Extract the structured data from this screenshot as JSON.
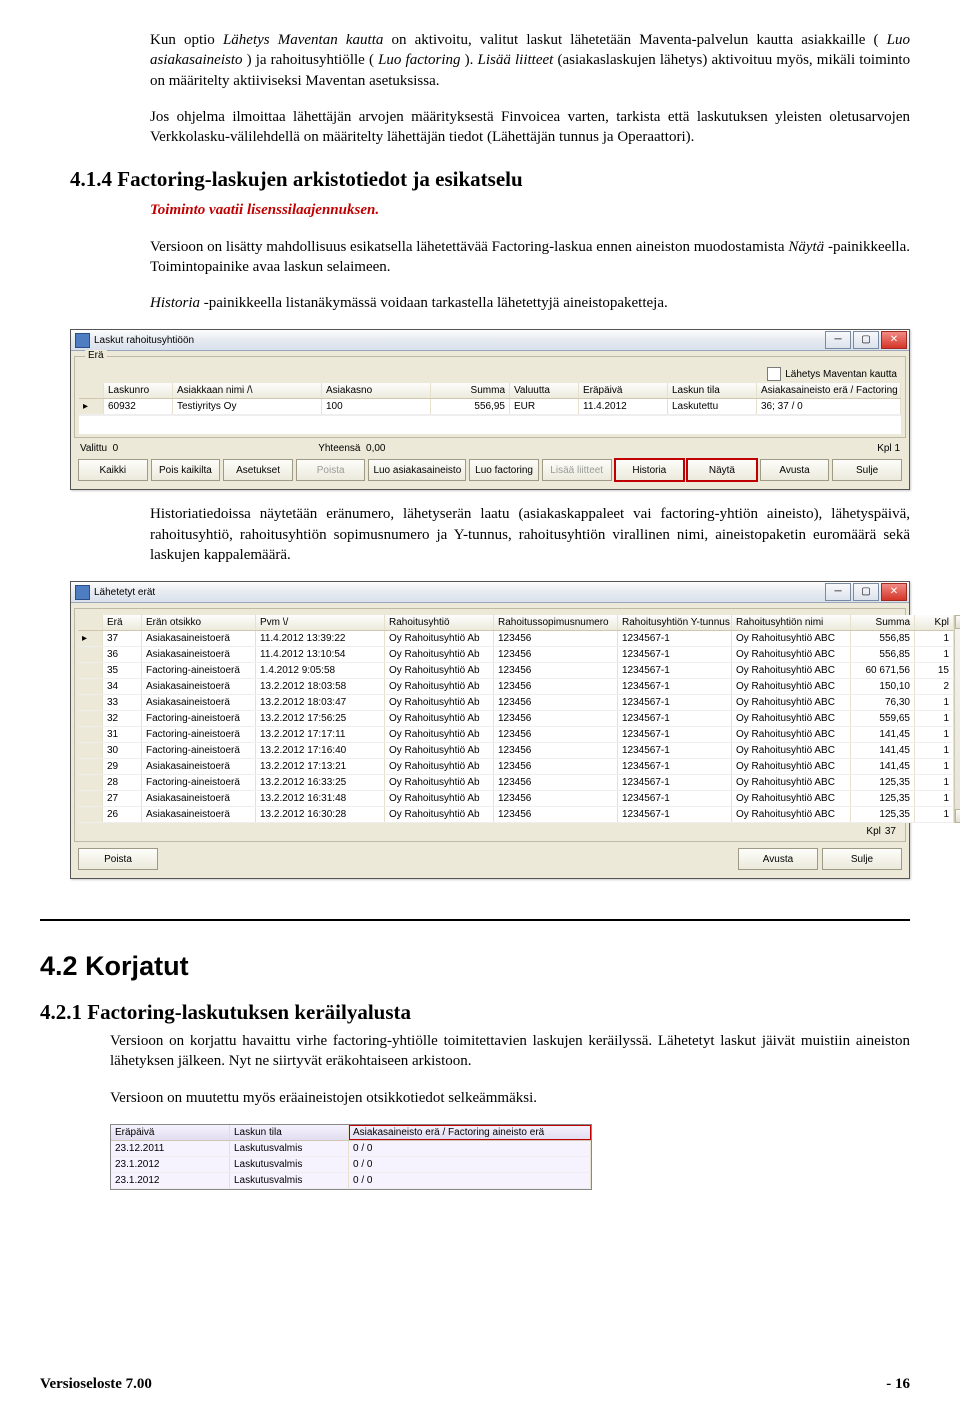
{
  "intro": {
    "p1_a": "Kun optio ",
    "p1_b": "Lähetys Maventan kautta",
    "p1_c": " on aktivoitu, valitut laskut lähetetään Maventa-palvelun kautta asiakkaille (",
    "p1_d": "Luo asiakasaineisto",
    "p1_e": ") ja rahoitusyhtiölle (",
    "p1_f": "Luo factoring",
    "p1_g": "). ",
    "p1_h": "Lisää liitteet",
    "p1_i": " (asiakaslaskujen lähetys) aktivoituu myös, mikäli toiminto on määritelty aktiiviseksi Maventan asetuksissa.",
    "p2": "Jos ohjelma ilmoittaa lähettäjän arvojen määrityksestä Finvoicea varten, tarkista että laskutuksen yleisten oletusarvojen Verkkolasku-välilehdellä on määritelty lähettäjän tiedot (Lähettäjän tunnus ja Operaattori)."
  },
  "sec414": {
    "num": "4.1.4",
    "title": "Factoring-laskujen arkistotiedot ja esikatselu",
    "req": "Toiminto vaatii lisenssilaajennuksen.",
    "p1_a": "Versioon on lisätty mahdollisuus esikatsella lähetettävää Factoring-laskua ennen aineiston muodostamista ",
    "p1_b": "Näytä",
    "p1_c": "-painikkeella. Toimintopainike avaa laskun selaimeen.",
    "p2_a": "Historia",
    "p2_b": "-painikkeella listanäkymässä voidaan tarkastella lähetettyjä aineistopaketteja.",
    "p3": "Historiatiedoissa näytetään eränumero, lähetyserän laatu (asiakaskappaleet vai factoring-yhtiön aineisto), lähetyspäivä, rahoitusyhtiö, rahoitusyhtiön sopimusnumero ja Y-tunnus, rahoitusyhtiön virallinen nimi, aineistopaketin euromäärä sekä laskujen kappalemäärä."
  },
  "shot1": {
    "title": "Laskut rahoitusyhtiöön",
    "gbox": "Erä",
    "chk": "Lähetys Maventan kautta",
    "cols": [
      "Laskunro",
      "Asiakkaan nimi /\\",
      "Asiakasno",
      "Summa",
      "Valuutta",
      "Eräpäivä",
      "Laskun tila",
      "Asiakasaineisto erä / Factoring aineisto erä"
    ],
    "row": [
      "60932",
      "Testiyritys Oy",
      "100",
      "556,95",
      "EUR",
      "11.4.2012",
      "Laskutettu",
      "36; 37 / 0"
    ],
    "status": {
      "valittu_l": "Valittu",
      "valittu_v": "0",
      "yht_l": "Yhteensä",
      "yht_v": "0,00",
      "kpl_l": "Kpl",
      "kpl_v": "1"
    },
    "buttons": [
      "Kaikki",
      "Pois kaikilta",
      "Asetukset",
      "Poista",
      "Luo asiakasaineisto",
      "Luo factoring",
      "Lisää liitteet",
      "Historia",
      "Näytä",
      "Avusta",
      "Sulje"
    ]
  },
  "shot2": {
    "title": "Lähetetyt erät",
    "cols": [
      "Erä",
      "Erän otsikko",
      "Pvm \\/",
      "Rahoitusyhtiö",
      "Rahoitussopimusnumero",
      "Rahoitusyhtiön Y-tunnus",
      "Rahoitusyhtiön nimi",
      "Summa",
      "Kpl"
    ],
    "rows": [
      [
        "37",
        "Asiakasaineistoerä",
        "11.4.2012 13:39:22",
        "Oy Rahoitusyhtiö Ab",
        "123456",
        "1234567-1",
        "Oy Rahoitusyhtiö ABC",
        "556,85",
        "1"
      ],
      [
        "36",
        "Asiakasaineistoerä",
        "11.4.2012 13:10:54",
        "Oy Rahoitusyhtiö Ab",
        "123456",
        "1234567-1",
        "Oy Rahoitusyhtiö ABC",
        "556,85",
        "1"
      ],
      [
        "35",
        "Factoring-aineistoerä",
        "1.4.2012 9:05:58",
        "Oy Rahoitusyhtiö Ab",
        "123456",
        "1234567-1",
        "Oy Rahoitusyhtiö ABC",
        "60 671,56",
        "15"
      ],
      [
        "34",
        "Asiakasaineistoerä",
        "13.2.2012 18:03:58",
        "Oy Rahoitusyhtiö Ab",
        "123456",
        "1234567-1",
        "Oy Rahoitusyhtiö ABC",
        "150,10",
        "2"
      ],
      [
        "33",
        "Asiakasaineistoerä",
        "13.2.2012 18:03:47",
        "Oy Rahoitusyhtiö Ab",
        "123456",
        "1234567-1",
        "Oy Rahoitusyhtiö ABC",
        "76,30",
        "1"
      ],
      [
        "32",
        "Factoring-aineistoerä",
        "13.2.2012 17:56:25",
        "Oy Rahoitusyhtiö Ab",
        "123456",
        "1234567-1",
        "Oy Rahoitusyhtiö ABC",
        "559,65",
        "1"
      ],
      [
        "31",
        "Factoring-aineistoerä",
        "13.2.2012 17:17:11",
        "Oy Rahoitusyhtiö Ab",
        "123456",
        "1234567-1",
        "Oy Rahoitusyhtiö ABC",
        "141,45",
        "1"
      ],
      [
        "30",
        "Factoring-aineistoerä",
        "13.2.2012 17:16:40",
        "Oy Rahoitusyhtiö Ab",
        "123456",
        "1234567-1",
        "Oy Rahoitusyhtiö ABC",
        "141,45",
        "1"
      ],
      [
        "29",
        "Asiakasaineistoerä",
        "13.2.2012 17:13:21",
        "Oy Rahoitusyhtiö Ab",
        "123456",
        "1234567-1",
        "Oy Rahoitusyhtiö ABC",
        "141,45",
        "1"
      ],
      [
        "28",
        "Factoring-aineistoerä",
        "13.2.2012 16:33:25",
        "Oy Rahoitusyhtiö Ab",
        "123456",
        "1234567-1",
        "Oy Rahoitusyhtiö ABC",
        "125,35",
        "1"
      ],
      [
        "27",
        "Asiakasaineistoerä",
        "13.2.2012 16:31:48",
        "Oy Rahoitusyhtiö Ab",
        "123456",
        "1234567-1",
        "Oy Rahoitusyhtiö ABC",
        "125,35",
        "1"
      ],
      [
        "26",
        "Asiakasaineistoerä",
        "13.2.2012 16:30:28",
        "Oy Rahoitusyhtiö Ab",
        "123456",
        "1234567-1",
        "Oy Rahoitusyhtiö ABC",
        "125,35",
        "1"
      ]
    ],
    "kpl_l": "Kpl",
    "kpl_v": "37",
    "buttons": [
      "Poista",
      "Avusta",
      "Sulje"
    ]
  },
  "sec42": {
    "num": "4.2",
    "title": "Korjatut"
  },
  "sec421": {
    "num": "4.2.1",
    "title": "Factoring-laskutuksen keräilyalusta",
    "p1": "Versioon on korjattu havaittu virhe factoring-yhtiölle toimitettavien laskujen keräilyssä. Lähetetyt laskut jäivät muistiin aineiston lähetyksen jälkeen. Nyt ne siirtyvät eräkohtaiseen arkistoon.",
    "p2": "Versioon on muutettu myös eräaineistojen otsikkotiedot selkeämmäksi."
  },
  "shot3": {
    "cols": [
      "Eräpäivä",
      "Laskun tila",
      "Asiakasaineisto erä / Factoring aineisto erä"
    ],
    "rows": [
      [
        "23.12.2011",
        "Laskutusvalmis",
        "0 / 0"
      ],
      [
        "23.1.2012",
        "Laskutusvalmis",
        "0 / 0"
      ],
      [
        "23.1.2012",
        "Laskutusvalmis",
        "0 / 0"
      ]
    ]
  },
  "footer": {
    "left": "Versioseloste 7.00",
    "right": "- 16"
  }
}
